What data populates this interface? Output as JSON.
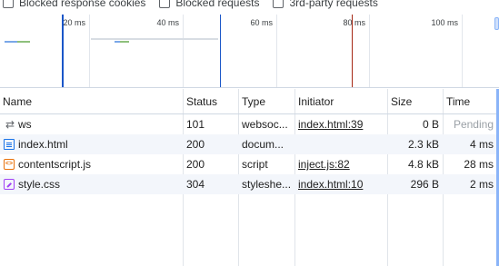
{
  "filters": [
    {
      "label": "Blocked response cookies",
      "checked": false
    },
    {
      "label": "Blocked requests",
      "checked": false
    },
    {
      "label": "3rd-party requests",
      "checked": false
    }
  ],
  "overview": {
    "ticks": [
      "20 ms",
      "40 ms",
      "60 ms",
      "80 ms",
      "100 ms"
    ]
  },
  "table": {
    "headers": {
      "name": "Name",
      "status": "Status",
      "type": "Type",
      "initiator": "Initiator",
      "size": "Size",
      "time": "Time"
    },
    "rows": [
      {
        "icon": "websocket-icon",
        "name": "ws",
        "status": "101",
        "type": "websoc...",
        "initiator": "index.html:39",
        "size": "0 B",
        "time": "Pending"
      },
      {
        "icon": "document-icon",
        "name": "index.html",
        "status": "200",
        "type": "docum...",
        "initiator": "",
        "size": "2.3 kB",
        "time": "4 ms"
      },
      {
        "icon": "script-icon",
        "name": "contentscript.js",
        "status": "200",
        "type": "script",
        "initiator": "inject.js:82",
        "size": "4.8 kB",
        "time": "28 ms"
      },
      {
        "icon": "stylesheet-icon",
        "name": "style.css",
        "status": "304",
        "type": "styleshe...",
        "initiator": "index.html:10",
        "size": "296 B",
        "time": "2 ms"
      }
    ]
  },
  "colors": {
    "dom_content_loaded_marker": "#1a56c8",
    "load_marker": "#a52714",
    "header_border": "#cfd8e3",
    "alt_row": "#f3f6fb"
  }
}
